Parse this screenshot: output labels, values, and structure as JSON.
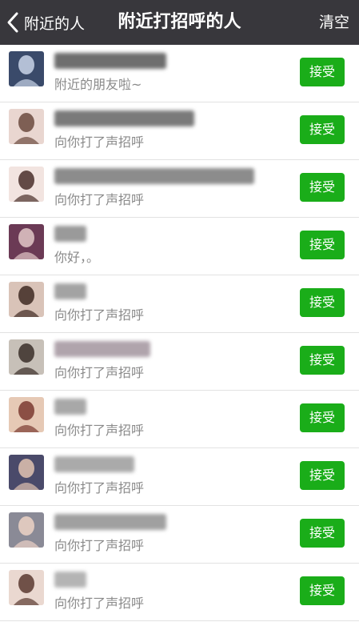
{
  "navbar": {
    "back_label": "附近的人",
    "title": "附近打招呼的人",
    "clear_label": "清空"
  },
  "accept_label": "接受",
  "requests": [
    {
      "message": "附近的朋友啦~",
      "avatar_bg": "#3a4a6a",
      "avatar_fg": "#c9d4e8",
      "name_color": "#6e6e6e"
    },
    {
      "message": "向你打了声招呼",
      "avatar_bg": "#e9d6d0",
      "avatar_fg": "#6b4a3e",
      "name_color": "#7a7a7a"
    },
    {
      "message": "向你打了声招呼",
      "avatar_bg": "#f2e4e0",
      "avatar_fg": "#4a2f2a",
      "name_color": "#8c8c8c"
    },
    {
      "message": "你好，。",
      "avatar_bg": "#6b3a55",
      "avatar_fg": "#e2c8c8",
      "name_color": "#9a9a9a"
    },
    {
      "message": "向你打了声招呼",
      "avatar_bg": "#d9c3b8",
      "avatar_fg": "#3e2a22",
      "name_color": "#a3a3a3"
    },
    {
      "message": "向你打了声招呼",
      "avatar_bg": "#c7c0b8",
      "avatar_fg": "#3a2e28",
      "name_color": "#b0a4ac"
    },
    {
      "message": "向你打了声招呼",
      "avatar_bg": "#e6c9b5",
      "avatar_fg": "#7a3a30",
      "name_color": "#a8a8a8"
    },
    {
      "message": "向你打了声招呼",
      "avatar_bg": "#4a4a6a",
      "avatar_fg": "#e0c2b0",
      "name_color": "#aaaaaa"
    },
    {
      "message": "向你打了声招呼",
      "avatar_bg": "#8a8a96",
      "avatar_fg": "#ecd2c6",
      "name_color": "#a0a0a0"
    },
    {
      "message": "向你打了声招呼",
      "avatar_bg": "#ead8d0",
      "avatar_fg": "#5a3a30",
      "name_color": "#b4b4b4"
    }
  ]
}
